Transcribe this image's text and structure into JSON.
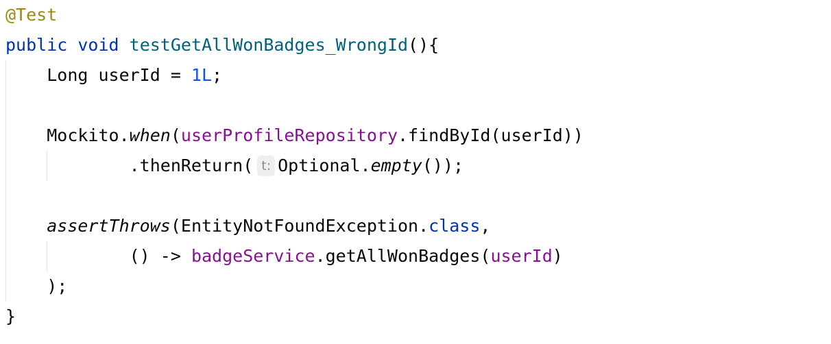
{
  "code": {
    "line1": {
      "annotation": "@Test"
    },
    "line2": {
      "kw_public": "public",
      "kw_void": "void",
      "method_name": "testGetAllWonBadges_WrongId",
      "rest": "(){"
    },
    "line3": {
      "indent": "    ",
      "type": "Long userId = ",
      "number": "1L",
      "end": ";"
    },
    "line5": {
      "indent": "    ",
      "class_call": "Mockito.",
      "when": "when",
      "open": "(",
      "repo_field": "userProfileRepository",
      "rest": ".findById(userId))"
    },
    "line6": {
      "indent": "            ",
      "then_return": ".thenReturn(",
      "hint": "t:",
      "optional": "Optional.",
      "empty": "empty",
      "end": "());"
    },
    "line8": {
      "indent": "    ",
      "assert_throws": "assertThrows",
      "open": "(EntityNotFoundException.",
      "kw_class": "class",
      "comma": ","
    },
    "line9": {
      "indent": "            ",
      "lambda": "() -> ",
      "service_field": "badgeService",
      "call": ".getAllWonBadges(",
      "param": "userId",
      "close": ")"
    },
    "line10": {
      "indent": "    ",
      "text": ");"
    },
    "line11": {
      "text": "}"
    }
  },
  "colors": {
    "background": "#ffffff",
    "text": "#080808",
    "annotation": "#9e880d",
    "keyword": "#0033b3",
    "method_declaration": "#00627a",
    "number": "#1750eb",
    "field": "#871094",
    "hint_background": "#efefef",
    "hint_text": "#8c8c8c"
  }
}
